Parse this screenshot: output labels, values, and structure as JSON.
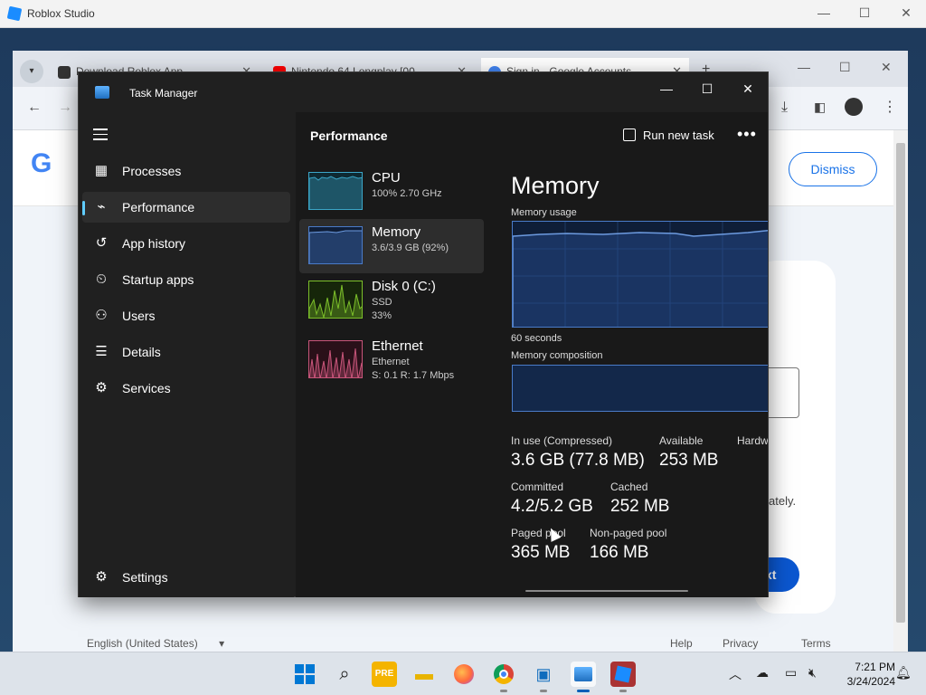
{
  "studio": {
    "title": "Roblox Studio"
  },
  "chrome": {
    "tabs": [
      {
        "label": "Download Roblox App",
        "color": "#333333"
      },
      {
        "label": "Nintendo 64 Longplay [00",
        "color": "#ff0000"
      },
      {
        "label": "Sign in - Google Accounts",
        "color": "#4285f4"
      }
    ],
    "dismiss_label": "Dismiss",
    "google_letter": "G",
    "next_label": "xt",
    "ately_text": "ately.",
    "footer": {
      "language": "English (United States)",
      "help": "Help",
      "privacy": "Privacy",
      "terms": "Terms"
    }
  },
  "tm": {
    "app_name": "Task Manager",
    "nav": [
      {
        "label": "Processes",
        "icon": "processes-icon"
      },
      {
        "label": "Performance",
        "icon": "performance-icon",
        "active": true
      },
      {
        "label": "App history",
        "icon": "app-history-icon"
      },
      {
        "label": "Startup apps",
        "icon": "startup-apps-icon"
      },
      {
        "label": "Users",
        "icon": "users-icon"
      },
      {
        "label": "Details",
        "icon": "details-icon"
      },
      {
        "label": "Services",
        "icon": "services-icon"
      }
    ],
    "settings_label": "Settings",
    "perf_title": "Performance",
    "run_task_label": "Run new task",
    "resources": [
      {
        "name": "CPU",
        "sub1": "100%  2.70 GHz",
        "sub2": "",
        "color": "#3ba6c8"
      },
      {
        "name": "Memory",
        "sub1": "3.6/3.9 GB (92%)",
        "sub2": "",
        "color": "#4a7bc8"
      },
      {
        "name": "Disk 0 (C:)",
        "sub1": "SSD",
        "sub2": "33%",
        "color": "#7cbf2a"
      },
      {
        "name": "Ethernet",
        "sub1": "Ethernet",
        "sub2": "S: 0.1  R: 1.7 Mbps",
        "color": "#c8557a"
      }
    ],
    "detail": {
      "title": "Memory",
      "usage_label": "Memory usage",
      "seconds_label": "60 seconds",
      "composition_label": "Memory composition",
      "stats": {
        "in_use_label": "In use (Compressed)",
        "in_use_value": "3.6 GB (77.8 MB)",
        "available_label": "Available",
        "available_value": "253 MB",
        "hardware_label": "Hardw",
        "committed_label": "Committed",
        "committed_value": "4.2/5.2 GB",
        "cached_label": "Cached",
        "cached_value": "252 MB",
        "paged_label": "Paged pool",
        "paged_value": "365 MB",
        "nonpaged_label": "Non-paged pool",
        "nonpaged_value": "166 MB"
      }
    }
  },
  "taskbar": {
    "time": "7:21 PM",
    "date": "3/24/2024"
  }
}
